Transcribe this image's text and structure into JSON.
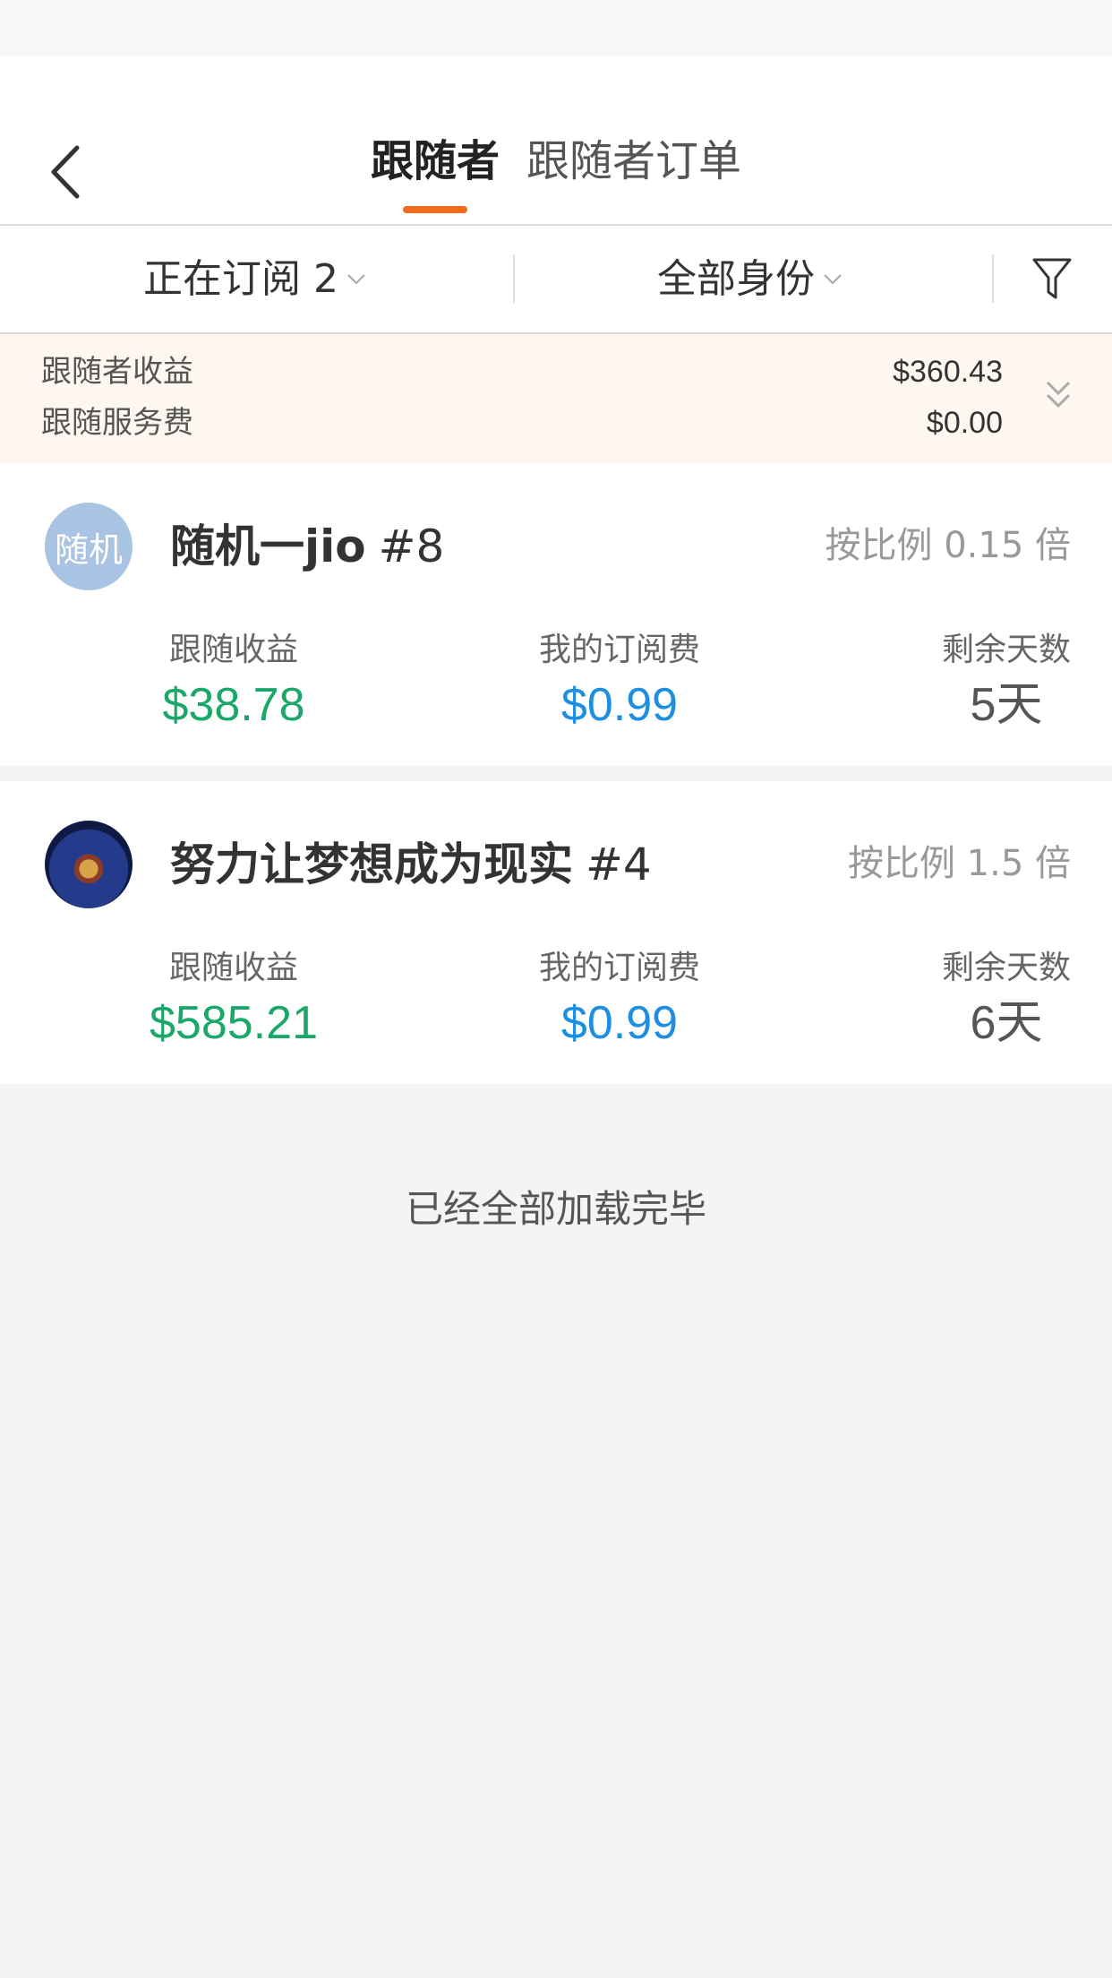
{
  "header": {
    "tabs": [
      {
        "label": "跟随者",
        "active": true
      },
      {
        "label": "跟随者订单",
        "active": false
      }
    ],
    "back_icon": "chevron-left-icon",
    "accent_color": "#f26a1b"
  },
  "filters": {
    "subscribing_label": "正在订阅 2",
    "identity_label": "全部身份",
    "filter_icon": "funnel-icon"
  },
  "summary": {
    "follower_income_label": "跟随者收益",
    "follower_income_value": "$360.43",
    "service_fee_label": "跟随服务费",
    "service_fee_value": "$0.00",
    "expand_icon": "double-chevron-down-icon"
  },
  "followers": [
    {
      "avatar_text": "随机",
      "name": "随机一jio",
      "rank": "#8",
      "ratio": "按比例 0.15 倍",
      "income_label": "跟随收益",
      "income_value": "$38.78",
      "fee_label": "我的订阅费",
      "fee_value": "$0.99",
      "days_label": "剩余天数",
      "days_value": "5天"
    },
    {
      "avatar_text": "",
      "name": "努力让梦想成为现实",
      "rank": "#4",
      "ratio": "按比例 1.5 倍",
      "income_label": "跟随收益",
      "income_value": "$585.21",
      "fee_label": "我的订阅费",
      "fee_value": "$0.99",
      "days_label": "剩余天数",
      "days_value": "6天"
    }
  ],
  "footer": {
    "end_text": "已经全部加载完毕"
  },
  "colors": {
    "income": "#1aa86a",
    "fee": "#1e8fe0",
    "summary_bg": "#fdf7ef"
  }
}
